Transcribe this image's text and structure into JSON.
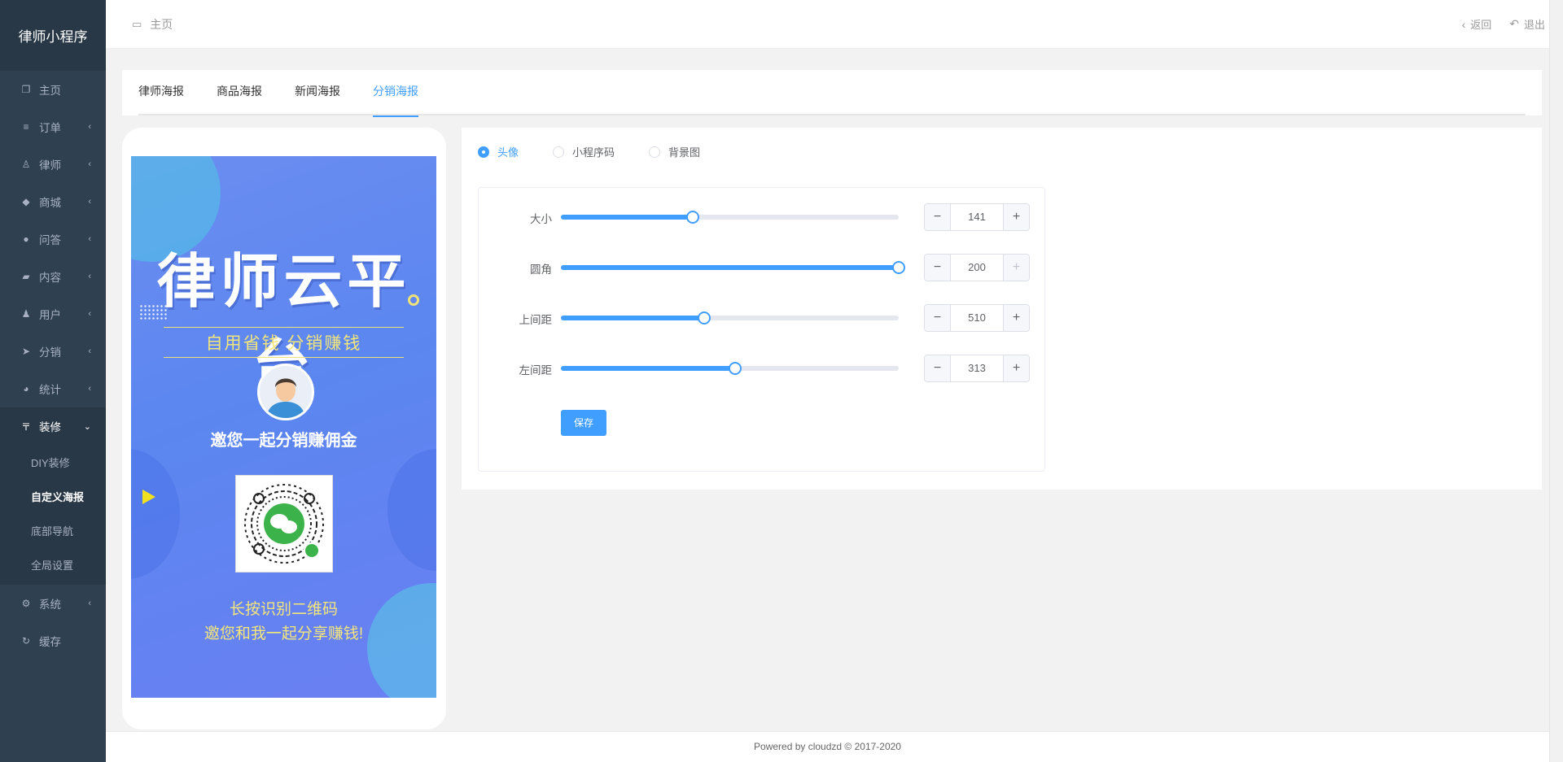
{
  "sidebar": {
    "brand": "律师小程序",
    "items": [
      {
        "label": "主页",
        "icon": "copy-icon"
      },
      {
        "label": "订单",
        "icon": "list-icon"
      },
      {
        "label": "律师",
        "icon": "user-outline-icon"
      },
      {
        "label": "商城",
        "icon": "tags-icon"
      },
      {
        "label": "问答",
        "icon": "comment-icon"
      },
      {
        "label": "内容",
        "icon": "book-icon"
      },
      {
        "label": "用户",
        "icon": "user-icon"
      },
      {
        "label": "分销",
        "icon": "paper-plane-icon"
      },
      {
        "label": "统计",
        "icon": "pie-chart-icon"
      },
      {
        "label": "装修",
        "icon": "paint-icon"
      }
    ],
    "decor_sub": [
      "DIY装修",
      "自定义海报",
      "底部导航",
      "全局设置"
    ],
    "bottom_items": [
      {
        "label": "系统",
        "icon": "gear-icon"
      },
      {
        "label": "缓存",
        "icon": "refresh-icon"
      }
    ]
  },
  "header": {
    "breadcrumb": "主页",
    "back": "返回",
    "logout": "退出"
  },
  "tabs": [
    "律师海报",
    "商品海报",
    "新闻海报",
    "分销海报"
  ],
  "poster": {
    "title": "律师云平台",
    "slogan": "自用省钱 分销赚钱",
    "invite": "邀您一起分销赚佣金",
    "tip1": "长按识别二维码",
    "tip2": "邀您和我一起分享赚钱!"
  },
  "editor": {
    "radios": [
      "头像",
      "小程序码",
      "背景图"
    ],
    "fields": [
      {
        "label": "大小",
        "value": "141",
        "percent": 39
      },
      {
        "label": "圆角",
        "value": "200",
        "percent": 100
      },
      {
        "label": "上间距",
        "value": "510",
        "percent": 42.5
      },
      {
        "label": "左间距",
        "value": "313",
        "percent": 51.5
      }
    ],
    "save": "保存"
  },
  "footer": "Powered by cloudzd © 2017-2020",
  "colors": {
    "primary": "#409eff",
    "sidebar": "#2f4050",
    "sidebar_dark": "#293846"
  }
}
